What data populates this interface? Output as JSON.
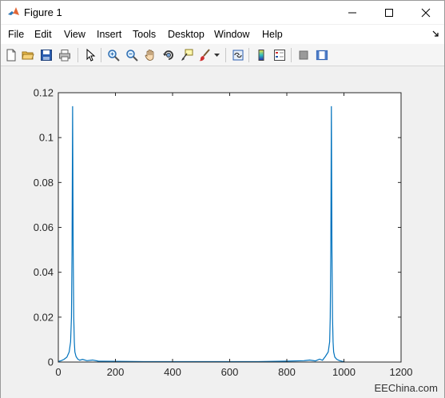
{
  "window": {
    "title": "Figure 1"
  },
  "menubar": {
    "items": [
      "File",
      "Edit",
      "View",
      "Insert",
      "Tools",
      "Desktop",
      "Window",
      "Help"
    ]
  },
  "toolbar": {
    "icons": [
      "new-figure-icon",
      "open-file-icon",
      "save-icon",
      "print-icon",
      "pointer-icon",
      "zoom-in-icon",
      "zoom-out-icon",
      "pan-hand-icon",
      "rotate-3d-icon",
      "data-cursor-icon",
      "brush-icon",
      "link-plot-icon",
      "colorbar-icon",
      "legend-icon",
      "hide-plot-tools-icon",
      "show-plot-tools-icon"
    ]
  },
  "colors": {
    "line": "#0072bd",
    "axes_bg": "#ffffff",
    "figure_bg": "#f0f0f0"
  },
  "chart_data": {
    "type": "line",
    "title": "",
    "xlabel": "",
    "ylabel": "",
    "xlim": [
      0,
      1200
    ],
    "ylim": [
      0,
      0.12
    ],
    "xticks": [
      "0",
      "200",
      "400",
      "600",
      "800",
      "1000",
      "1200"
    ],
    "yticks": [
      "0",
      "0.02",
      "0.04",
      "0.06",
      "0.08",
      "0.1",
      "0.12"
    ],
    "grid": false,
    "x": [
      0,
      10,
      20,
      30,
      38,
      43,
      46,
      48,
      50,
      52,
      54,
      56,
      58,
      62,
      68,
      75,
      85,
      100,
      120,
      140,
      200,
      300,
      400,
      500,
      600,
      700,
      800,
      860,
      880,
      900,
      915,
      925,
      935,
      945,
      950,
      952,
      954,
      956,
      958,
      960,
      962,
      964,
      968,
      975,
      985,
      995,
      1000,
      1002
    ],
    "y": [
      0.0003,
      0.0006,
      0.0012,
      0.0022,
      0.0045,
      0.009,
      0.02,
      0.05,
      0.114,
      0.05,
      0.02,
      0.009,
      0.0045,
      0.0025,
      0.0013,
      0.0008,
      0.0012,
      0.0006,
      0.0009,
      0.0004,
      0.0003,
      0.0002,
      0.0002,
      0.0002,
      0.0002,
      0.0002,
      0.0004,
      0.0006,
      0.0009,
      0.0005,
      0.0013,
      0.0008,
      0.0025,
      0.0045,
      0.009,
      0.02,
      0.05,
      0.114,
      0.05,
      0.02,
      0.009,
      0.0045,
      0.0022,
      0.0012,
      0.0006,
      0.0003,
      0.0002,
      0.0
    ]
  },
  "watermark": "EEChina.com"
}
